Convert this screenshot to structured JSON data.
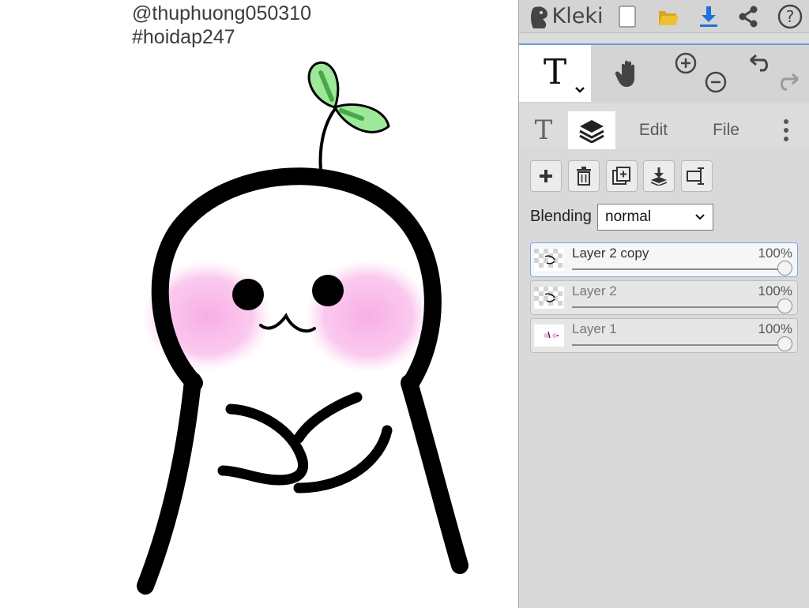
{
  "canvas": {
    "handle": "@thuphuong050310",
    "hashtag": "#hoidap247"
  },
  "app": {
    "name": "Kleki"
  },
  "tools": {
    "current_tool": "T",
    "hand": "hand-icon",
    "zoom_in": "zoom-in-icon",
    "zoom_out": "zoom-out-icon"
  },
  "tabs": {
    "text_tab": "T",
    "edit": "Edit",
    "file": "File"
  },
  "layers_panel": {
    "blending_label": "Blending",
    "blending_value": "normal",
    "layers": [
      {
        "name": "Layer 2 copy",
        "opacity": "100%",
        "opacity_value": 1.0,
        "selected": true
      },
      {
        "name": "Layer 2",
        "opacity": "100%",
        "opacity_value": 1.0,
        "selected": false
      },
      {
        "name": "Layer 1",
        "opacity": "100%",
        "opacity_value": 1.0,
        "selected": false
      }
    ]
  },
  "colors": {
    "download_accent": "#1e73d6",
    "folder_yellow": "#f0c030",
    "selection_blue": "#6b9be0",
    "leaf_green": "#9ee89a",
    "blush_pink": "#f7b6e6"
  }
}
